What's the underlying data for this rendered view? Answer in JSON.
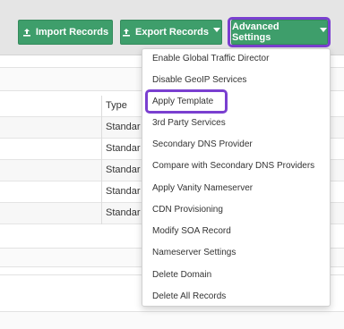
{
  "toolbar": {
    "import_label": "Import Records",
    "export_label": "Export Records",
    "advanced_label": "Advanced Settings"
  },
  "table": {
    "type_header": "Type",
    "rows": [
      "Standar",
      "Standar",
      "Standar",
      "Standar",
      "Standar"
    ]
  },
  "menu": {
    "items": [
      "Enable Global Traffic Director",
      "Disable GeoIP Services",
      "Apply Template",
      "3rd Party Services",
      "Secondary DNS Provider",
      "Compare with Secondary DNS Providers",
      "Apply Vanity Nameserver",
      "CDN Provisioning",
      "Modify SOA Record",
      "Nameserver Settings",
      "Delete Domain",
      "Delete All Records"
    ],
    "highlighted": "Apply Template"
  },
  "colors": {
    "button_green": "#3e9e6b",
    "highlight_purple": "#7a3fd0"
  }
}
